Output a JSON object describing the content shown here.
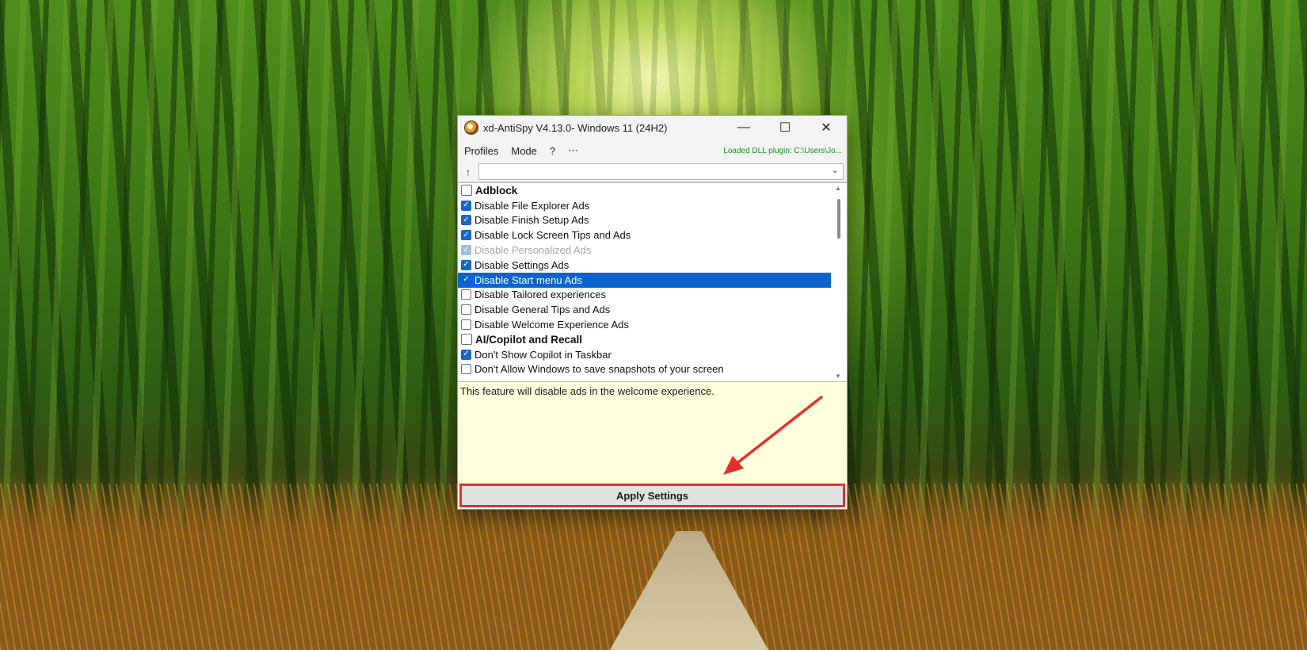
{
  "window": {
    "title": "xd-AntiSpy V4.13.0- Windows 11 (24H2)",
    "controls": {
      "minimize": "—",
      "maximize": "☐",
      "close": "✕"
    }
  },
  "menu": {
    "items": [
      "Profiles",
      "Mode",
      "?",
      "⋯"
    ],
    "plugin_status": "Loaded DLL plugin: C:\\Users\\Jo..."
  },
  "search": {
    "up_icon": "↑",
    "value": ""
  },
  "list": {
    "rows": [
      {
        "label": "Adblock",
        "type": "category",
        "checked": false
      },
      {
        "label": "Disable File Explorer Ads",
        "type": "item",
        "checked": true
      },
      {
        "label": "Disable Finish Setup Ads",
        "type": "item",
        "checked": true
      },
      {
        "label": "Disable Lock Screen Tips and Ads",
        "type": "item",
        "checked": true
      },
      {
        "label": "Disable Personalized Ads",
        "type": "item",
        "checked": true,
        "disabled": true
      },
      {
        "label": "Disable Settings Ads",
        "type": "item",
        "checked": true
      },
      {
        "label": "Disable Start menu Ads",
        "type": "item",
        "checked": true,
        "selected": true
      },
      {
        "label": "Disable Tailored experiences",
        "type": "item",
        "checked": false
      },
      {
        "label": "Disable General Tips and Ads",
        "type": "item",
        "checked": false
      },
      {
        "label": "Disable Welcome Experience Ads",
        "type": "item",
        "checked": false
      },
      {
        "label": "AI/Copilot and Recall",
        "type": "category",
        "checked": false
      },
      {
        "label": "Don't Show Copilot in Taskbar",
        "type": "item",
        "checked": true
      },
      {
        "label": "Don't Allow Windows to save snapshots of your screen",
        "type": "item",
        "checked": false
      }
    ]
  },
  "description": "This feature will disable ads in the welcome experience.",
  "apply_button": "Apply Settings",
  "colors": {
    "selection": "#0a63cf",
    "checkbox_on": "#1668c6",
    "highlight": "#e0322b",
    "description_bg": "#ffffdd",
    "status_text": "#1b8f2a"
  }
}
